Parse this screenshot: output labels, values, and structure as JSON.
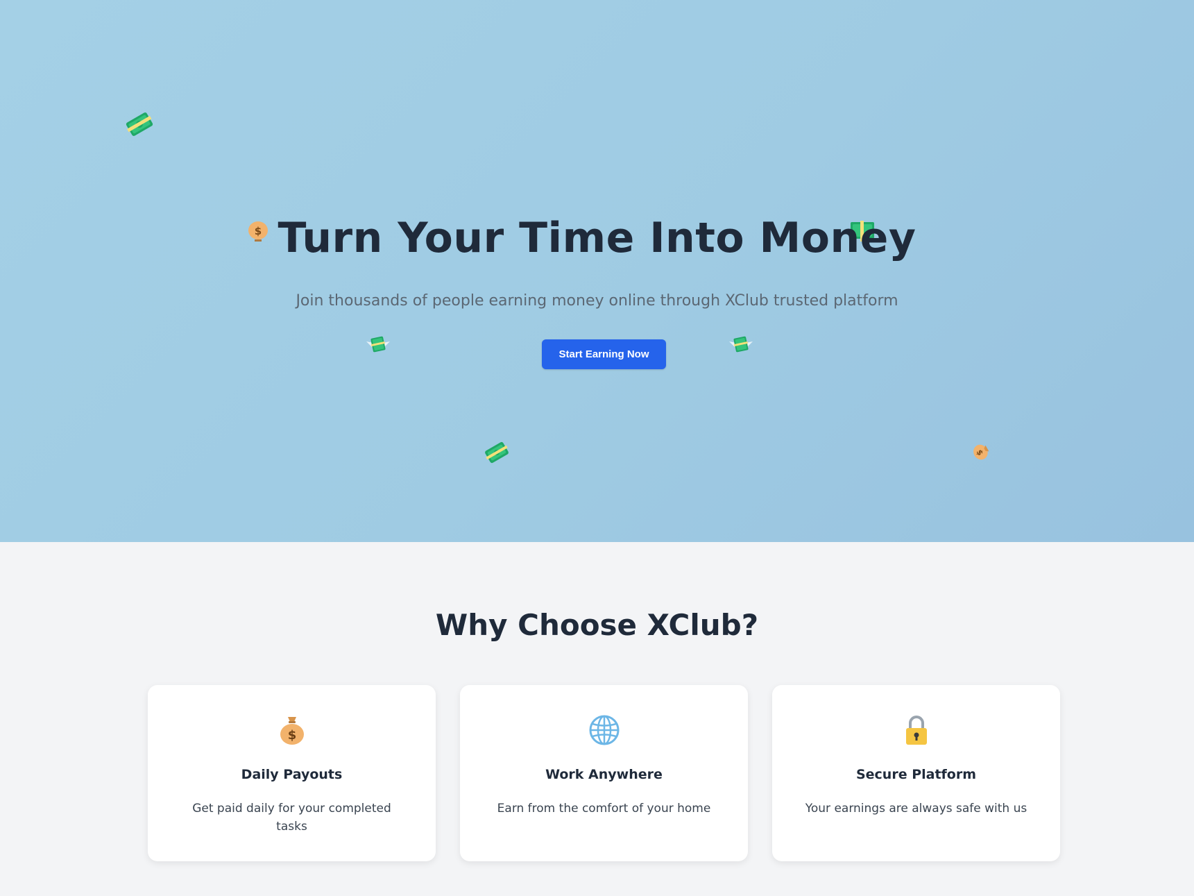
{
  "hero": {
    "title": "Turn Your Time Into Money",
    "subtitle": "Join thousands of people earning money online through XClub trusted platform",
    "cta_label": "Start Earning Now",
    "floating_icons": [
      "money-bill-icon",
      "dollar-coin-icon",
      "money-stack-icon",
      "money-with-wings-icon",
      "money-with-wings-icon",
      "money-bill-icon",
      "money-bag-icon"
    ]
  },
  "features": {
    "title": "Why Choose XClub?",
    "cards": [
      {
        "icon": "money-bag-icon",
        "title": "Daily Payouts",
        "description": "Get paid daily for your completed tasks"
      },
      {
        "icon": "globe-icon",
        "title": "Work Anywhere",
        "description": "Earn from the comfort of your home"
      },
      {
        "icon": "padlock-icon",
        "title": "Secure Platform",
        "description": "Your earnings are always safe with us"
      }
    ]
  },
  "colors": {
    "hero_bg": "#a0cce4",
    "primary_button": "#2563eb",
    "heading": "#1f2a3a",
    "section_bg": "#f3f4f6",
    "card_bg": "#ffffff"
  }
}
